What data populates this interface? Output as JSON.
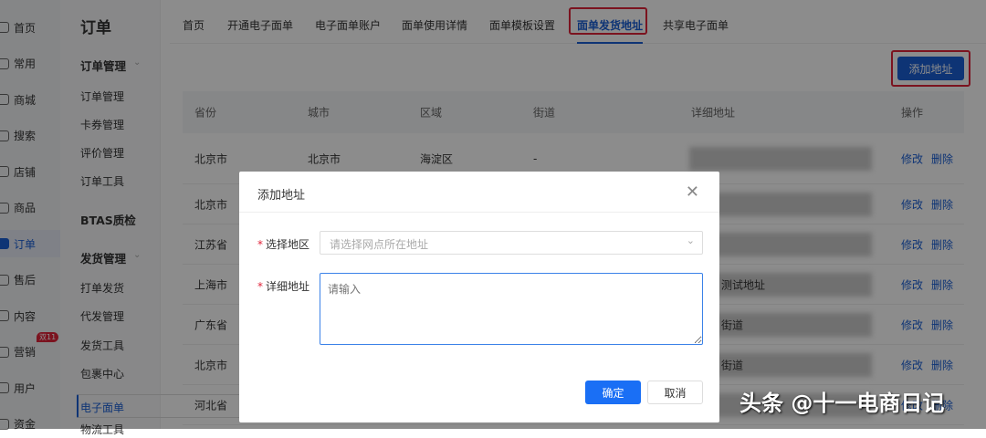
{
  "nav_primary": [
    {
      "label": "首页"
    },
    {
      "label": "常用"
    },
    {
      "label": "商城"
    },
    {
      "label": "搜索"
    },
    {
      "label": "店铺"
    },
    {
      "label": "商品"
    },
    {
      "label": "订单",
      "active": true
    },
    {
      "label": "售后"
    },
    {
      "label": "内容"
    },
    {
      "label": "营销",
      "badge": "双11"
    },
    {
      "label": "用户"
    },
    {
      "label": "资金"
    }
  ],
  "nav_secondary": {
    "title": "订单",
    "groups": [
      "订单管理",
      "BTAS质检",
      "发货管理"
    ],
    "items": [
      "订单管理",
      "卡券管理",
      "评价管理",
      "订单工具",
      "打单发货",
      "代发管理",
      "发货工具",
      "包裹中心",
      "电子面单",
      "物流工具"
    ]
  },
  "tabs": [
    "首页",
    "开通电子面单",
    "电子面单账户",
    "面单使用详情",
    "面单模板设置",
    "面单发货地址",
    "共享电子面单"
  ],
  "add_button": "添加地址",
  "table": {
    "headers": [
      "省份",
      "城市",
      "区域",
      "街道",
      "详细地址",
      "操作"
    ],
    "rows": [
      [
        "北京市",
        "北京市",
        "海淀区",
        "-",
        ""
      ],
      [
        "北京市",
        "",
        "",
        "",
        ""
      ],
      [
        "江苏省",
        "",
        "",
        "",
        ""
      ],
      [
        "上海市",
        "",
        "",
        "",
        "测试地址"
      ],
      [
        "广东省",
        "",
        "",
        "",
        "街道"
      ],
      [
        "北京市",
        "",
        "",
        "",
        "街道"
      ],
      [
        "河北省",
        "",
        "",
        "",
        ""
      ]
    ],
    "actions": [
      "修改",
      "删除"
    ]
  },
  "dialog": {
    "title": "添加地址",
    "region_label": "选择地区",
    "region_placeholder": "请选择网点所在地址",
    "detail_label": "详细地址",
    "detail_placeholder": "请输入",
    "required_mark": "*",
    "ok": "确定",
    "cancel": "取消"
  },
  "watermark": "头条 @十一电商日记"
}
